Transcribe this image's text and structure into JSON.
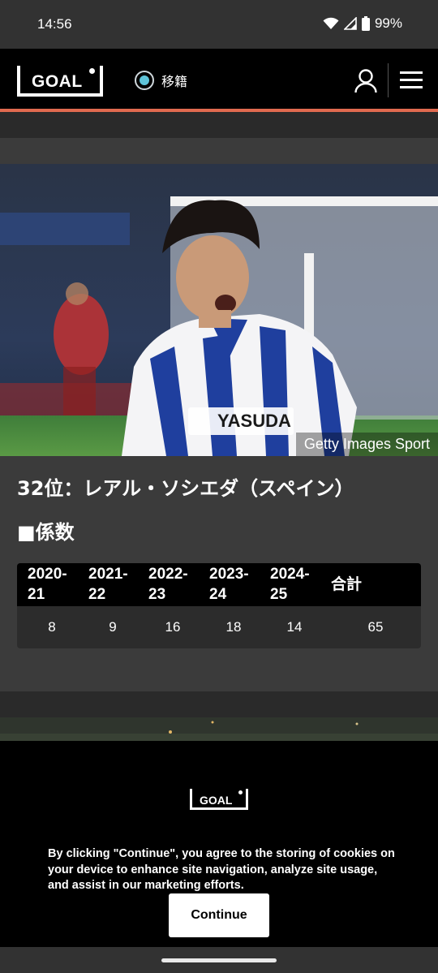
{
  "status_bar": {
    "time": "14:56",
    "battery": "99%",
    "icons": [
      "wifi-icon",
      "signal-icon",
      "battery-icon"
    ]
  },
  "header": {
    "logo_text": "GOAL",
    "nav_label": "移籍",
    "icons": [
      "user-icon",
      "menu-icon"
    ],
    "accent_color": "#e06a4f"
  },
  "article": {
    "photo_credit": "Getty Images Sport",
    "headline": "32位：レアル・ソシエダ（スペイン）",
    "subhead": "■係数",
    "table": {
      "headers": [
        [
          "2020-",
          "21"
        ],
        [
          "2021-",
          "22"
        ],
        [
          "2022-",
          "23"
        ],
        [
          "2023-",
          "24"
        ],
        [
          "2024-",
          "25"
        ],
        [
          "合計"
        ]
      ],
      "values": [
        "8",
        "9",
        "16",
        "18",
        "14",
        "65"
      ]
    }
  },
  "cookie_banner": {
    "logo_text": "GOAL",
    "text": "By clicking \"Continue\", you agree to the storing of cookies on your device to enhance site navigation, analyze site usage, and assist in our marketing efforts.",
    "button_label": "Continue"
  }
}
